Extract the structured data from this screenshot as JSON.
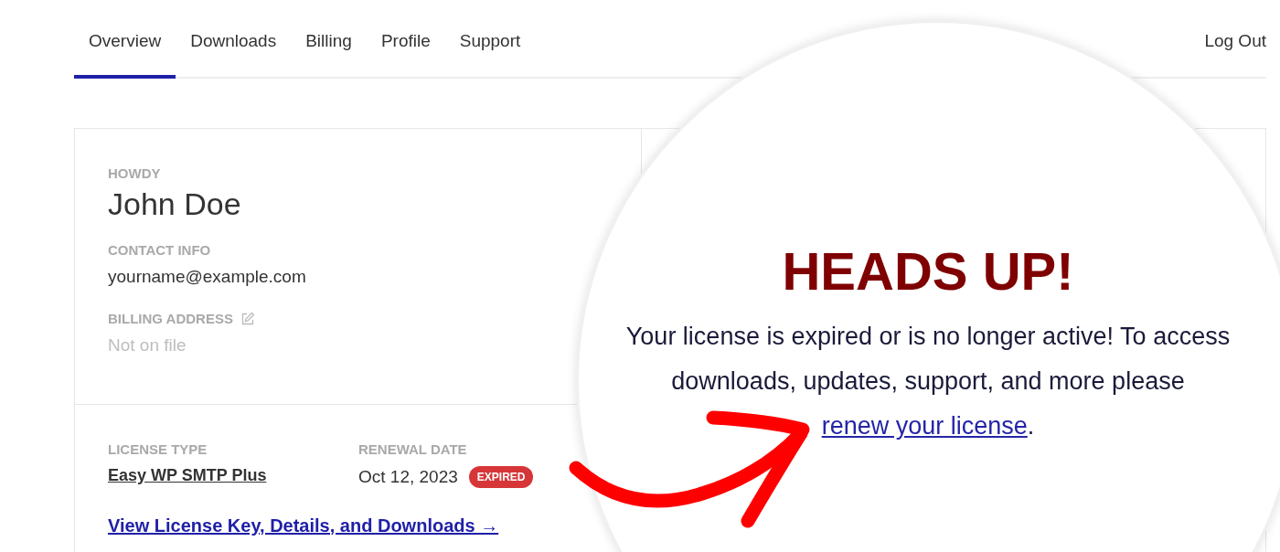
{
  "nav": {
    "tabs": [
      {
        "label": "Overview",
        "selected": true
      },
      {
        "label": "Downloads",
        "selected": false
      },
      {
        "label": "Billing",
        "selected": false
      },
      {
        "label": "Profile",
        "selected": false
      },
      {
        "label": "Support",
        "selected": false
      }
    ],
    "logout": "Log Out"
  },
  "account": {
    "howdy_label": "HOWDY",
    "name": "John Doe",
    "contact_label": "CONTACT INFO",
    "email": "yourname@example.com",
    "billing_label": "BILLING ADDRESS",
    "billing_value": "Not on file"
  },
  "license": {
    "type_label": "LICENSE TYPE",
    "type": "Easy WP SMTP Plus",
    "renewal_label": "RENEWAL DATE",
    "renewal_date": "Oct 12, 2023",
    "status": "EXPIRED",
    "link": "View License Key, Details, and Downloads →"
  },
  "notice": {
    "title": "HEADS UP!",
    "message": "Your license is expired or is no longer active! To access downloads, updates, support, and more please ",
    "link": "renew your license",
    "end": "."
  }
}
